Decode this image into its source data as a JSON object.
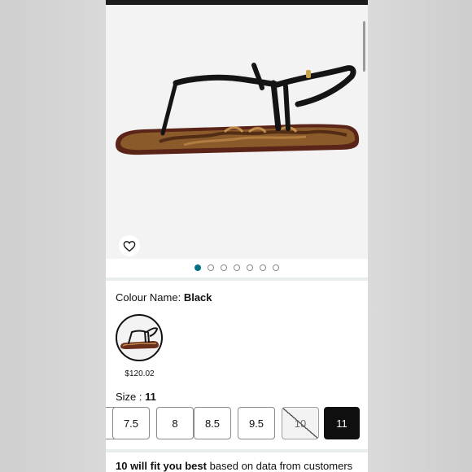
{
  "product": {
    "colour_label": "Colour Name: ",
    "colour_value": "Black",
    "swatch_price": "$120.02",
    "size_label": "Size : ",
    "size_value": "11",
    "image_count": 7,
    "active_image": 1
  },
  "sizes": [
    {
      "label": "7.5",
      "state": "available"
    },
    {
      "label": "8",
      "state": "available"
    },
    {
      "label": "8.5",
      "state": "available"
    },
    {
      "label": "9.5",
      "state": "available"
    },
    {
      "label": "10",
      "state": "unavailable"
    },
    {
      "label": "11",
      "state": "selected"
    }
  ],
  "fit": {
    "bold": "10 will fit you best",
    "rest": " based on data from customers"
  },
  "icons": {
    "wishlist": "heart-outline-icon"
  },
  "colors": {
    "accent": "#007185",
    "selected_size_bg": "#0f0f0f"
  }
}
